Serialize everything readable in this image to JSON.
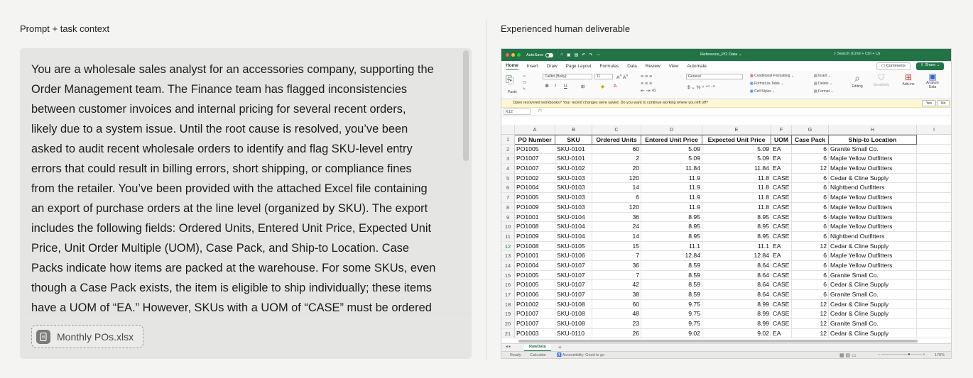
{
  "left": {
    "heading": "Prompt + task context",
    "prompt_lines": [
      "You are a wholesale sales analyst for an accessories company, supporting the",
      "Order Management team. The Finance team has flagged inconsistencies",
      "between customer invoices and internal pricing for several recent orders,",
      "likely due to a system issue. Until the root cause is resolved, you’ve been",
      "asked to audit recent wholesale orders to identify and flag SKU-level entry",
      "errors that could result in billing errors, short shipping, or compliance fines",
      "from the retailer. You’ve been provided with the attached Excel file containing",
      "an export of purchase orders at the line level (organized by SKU). The export",
      "includes the following fields: Ordered Units, Entered Unit Price, Expected Unit",
      "Price, Unit Order Multiple (UOM), Case Pack, and Ship-to Location. Case",
      "Packs indicate how items are packed at the warehouse. For some SKUs, even",
      "though a Case Pack exists, the item is eligible to ship individually; these items",
      "have a UOM of “EA.” However, SKUs with a UOM of “CASE” must be ordered"
    ],
    "attachment": "Monthly POs.xlsx"
  },
  "right": {
    "heading": "Experienced human deliverable",
    "excel": {
      "autosave": "AutoSave",
      "doc_title": "Reference_PO Data ⌄",
      "search": "Search (Cmd + Ctrl + U)",
      "menu": [
        "Home",
        "Insert",
        "Draw",
        "Page Layout",
        "Formulas",
        "Data",
        "Review",
        "View",
        "Automate"
      ],
      "comments": "Comments",
      "share": "Share",
      "ribbon": {
        "paste": "Paste",
        "font_name": "Calibri (Body)",
        "font_size": "11",
        "number_format": "General",
        "cond_format": "Conditional Formatting",
        "format_table": "Format as Table",
        "cell_styles": "Cell Styles",
        "insert": "Insert",
        "delete": "Delete",
        "format": "Format",
        "editing": "Editing",
        "sensitivity": "Sensitivity",
        "addins": "Add-ins",
        "analyze1": "Analyze",
        "analyze2": "Data"
      },
      "notice": "Open recovered workbooks?  Your recent changes were saved. Do you want to continue working where you left off?",
      "notice_yes": "Yes",
      "notice_no": "No",
      "name_box": "K12",
      "fx": "fx",
      "columns": [
        "A",
        "B",
        "C",
        "D",
        "E",
        "F",
        "G",
        "H",
        "I"
      ],
      "header_row": [
        "PO Number",
        "SKU",
        "Ordered Units",
        "Entered Unit Price",
        "Expected Unit Price",
        "UOM",
        "Case Pack",
        "Ship-to Location"
      ],
      "rows": [
        [
          "2",
          "PO1005",
          "SKU-0101",
          "60",
          "5.09",
          "5.09",
          "EA",
          "6",
          "Granite Small Co."
        ],
        [
          "3",
          "PO1007",
          "SKU-0101",
          "2",
          "5.09",
          "5.09",
          "EA",
          "6",
          "Maple Yellow Outfitters"
        ],
        [
          "4",
          "PO1007",
          "SKU-0102",
          "20",
          "11.84",
          "11.84",
          "EA",
          "12",
          "Maple Yellow Outfitters"
        ],
        [
          "5",
          "PO1002",
          "SKU-0103",
          "120",
          "11.9",
          "11.8",
          "CASE",
          "6",
          "Cedar & Cline Supply"
        ],
        [
          "6",
          "PO1004",
          "SKU-0103",
          "14",
          "11.9",
          "11.8",
          "CASE",
          "6",
          "Nightbend Outfitters"
        ],
        [
          "7",
          "PO1005",
          "SKU-0103",
          "6",
          "11.9",
          "11.8",
          "CASE",
          "6",
          "Maple Yellow Outfitters"
        ],
        [
          "8",
          "PO1009",
          "SKU-0103",
          "120",
          "11.9",
          "11.8",
          "CASE",
          "6",
          "Maple Yellow Outfitters"
        ],
        [
          "9",
          "PO1001",
          "SKU-0104",
          "36",
          "8.95",
          "8.95",
          "CASE",
          "6",
          "Maple Yellow Outfitters"
        ],
        [
          "10",
          "PO1008",
          "SKU-0104",
          "24",
          "8.95",
          "8.95",
          "CASE",
          "6",
          "Maple Yellow Outfitters"
        ],
        [
          "11",
          "PO1009",
          "SKU-0104",
          "14",
          "8.95",
          "8.95",
          "CASE",
          "6",
          "Nightbend Outfitters"
        ],
        [
          "12",
          "PO1008",
          "SKU-0105",
          "15",
          "11.1",
          "11.1",
          "EA",
          "12",
          "Cedar & Cline Supply"
        ],
        [
          "13",
          "PO1001",
          "SKU-0106",
          "7",
          "12.84",
          "12.84",
          "EA",
          "6",
          "Maple Yellow Outfitters"
        ],
        [
          "14",
          "PO1004",
          "SKU-0107",
          "36",
          "8.59",
          "8.64",
          "CASE",
          "6",
          "Maple Yellow Outfitters"
        ],
        [
          "15",
          "PO1005",
          "SKU-0107",
          "7",
          "8.59",
          "8.64",
          "CASE",
          "6",
          "Granite Small Co."
        ],
        [
          "16",
          "PO1005",
          "SKU-0107",
          "42",
          "8.59",
          "8.64",
          "CASE",
          "6",
          "Cedar & Cline Supply"
        ],
        [
          "17",
          "PO1006",
          "SKU-0107",
          "38",
          "8.59",
          "8.64",
          "CASE",
          "6",
          "Granite Small Co."
        ],
        [
          "18",
          "PO1002",
          "SKU-0108",
          "60",
          "9.75",
          "8.99",
          "CASE",
          "12",
          "Cedar & Cline Supply"
        ],
        [
          "19",
          "PO1007",
          "SKU-0108",
          "48",
          "9.75",
          "8.99",
          "CASE",
          "12",
          "Cedar & Cline Supply"
        ],
        [
          "20",
          "PO1007",
          "SKU-0108",
          "23",
          "9.75",
          "8.99",
          "CASE",
          "12",
          "Granite Small Co."
        ],
        [
          "21",
          "PO1003",
          "SKU-0110",
          "26",
          "9.02",
          "9.02",
          "EA",
          "12",
          "Cedar & Cline Supply"
        ]
      ],
      "sheet_tab": "RawData",
      "add_sheet": "+",
      "status_ready": "Ready",
      "status_calc": "Calculate",
      "status_access": "Accessibility: Good to go",
      "zoom": "178%"
    }
  }
}
